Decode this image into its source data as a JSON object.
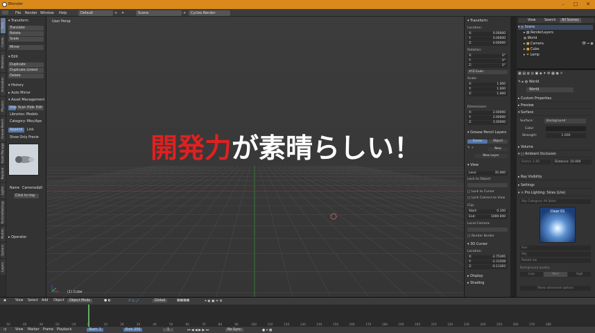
{
  "app": {
    "title": "Blender"
  },
  "menubar": {
    "items": [
      "File",
      "Render",
      "Window",
      "Help"
    ],
    "layout": "Default",
    "scene": "Scene",
    "engine": "Cycles Render"
  },
  "vtabs": [
    "Tools",
    "Create",
    "Relations",
    "Animation",
    "Physics",
    "Grease Pencil",
    "Asset Manage",
    "Replace",
    "Lights",
    "ParticleSettings",
    "Models",
    "Options",
    "Layers"
  ],
  "tools": {
    "transform_header": "Transform",
    "transform": [
      "Translate",
      "Rotate",
      "Scale",
      "Mirror"
    ],
    "edit_header": "Edit",
    "edit": [
      "Duplicate",
      "Duplicate Linked",
      "Delete"
    ],
    "history_header": "History",
    "history": [
      "Auto Mirror"
    ],
    "asset_header": "Asset Management",
    "asset_tabs": [
      "Import",
      "Scale",
      "Hide",
      "Edit"
    ],
    "asset_rows": [
      "Libraries: Models",
      "Category: Misc/Ape"
    ],
    "asset_buttons": [
      "Append",
      "Link"
    ],
    "show_only": "Show Only Previe",
    "name_label": "Name",
    "name_value": "Cameraobj0",
    "click_to_imp": "Click to imp",
    "operator": "Operator"
  },
  "viewport": {
    "label": "User Persp",
    "object": "(1) Cube"
  },
  "caption": {
    "red": "開発力",
    "white": "が素晴らしい！"
  },
  "rpanel": {
    "transform": "Transform",
    "location_label": "Location:",
    "location": [
      [
        "X:",
        "0.00000"
      ],
      [
        "Y:",
        "0.00000"
      ],
      [
        "Z:",
        "0.00000"
      ]
    ],
    "rotation_label": "Rotation:",
    "rotation": [
      [
        "X:",
        "0°"
      ],
      [
        "Y:",
        "0°"
      ],
      [
        "Z:",
        "0°"
      ]
    ],
    "rotation_mode": "XYZ Euler",
    "scale_label": "Scale:",
    "scale": [
      [
        "X:",
        "1.000"
      ],
      [
        "Y:",
        "1.000"
      ],
      [
        "Z:",
        "1.000"
      ]
    ],
    "dimensions_label": "Dimensions:",
    "dimensions": [
      [
        "X:",
        "2.00000"
      ],
      [
        "Y:",
        "2.00000"
      ],
      [
        "Z:",
        "2.00000"
      ]
    ],
    "layers_header": "Grease Pencil Layers",
    "layers_tabs": [
      "Scene",
      "Object"
    ],
    "new_label": "New",
    "new_layer": "New Layer",
    "view_header": "View",
    "lens_label": "Lens:",
    "lens_value": "35.000",
    "lock_to_object": "Lock to Object:",
    "lock_to_cursor": "Lock to Cursor",
    "lock_camera": "Lock Camera to View",
    "clip_label": "Clip:",
    "clip_start": [
      "Start:",
      "0.100"
    ],
    "clip_end": [
      "End:",
      "1000.000"
    ],
    "local_camera": "Local Camera:",
    "render_border": "Render Border",
    "cursor_header": "3D Cursor",
    "cursor_location": "Location:",
    "cursor": [
      [
        "X:",
        "-2.75395"
      ],
      [
        "Y:",
        "-2.31508"
      ],
      [
        "Z:",
        "-0.11393"
      ]
    ],
    "display": "Display",
    "shading": "Shading"
  },
  "outliner": {
    "menu": [
      "View",
      "Search",
      "All Scenes"
    ],
    "rows": [
      "Scene",
      "RenderLayers",
      "World",
      "Camera",
      "Cube",
      "Lamp"
    ]
  },
  "props": {
    "breadcrumb": "World",
    "world_name": "World",
    "sections": [
      "Custom Properties",
      "Preview",
      "Surface"
    ],
    "surface_label": "Surface:",
    "surface_value": "Background",
    "color_label": "Color:",
    "strength_label": "Strength:",
    "strength_value": "1.000",
    "volume": "Volume",
    "ao": "Ambient Occlusion",
    "factor": "Factor:",
    "factor_value": "1.00",
    "distance": "Distance:",
    "distance_value": "10.000",
    "ray_visibility": "Ray Visibility",
    "settings": "Settings",
    "prolight": "Pro Lighting: Skies (Lite)",
    "sky_category": "Sky Category: All Skies",
    "sky_name": "Clear 01",
    "sun_label": "Sun",
    "sky_label": "Sky",
    "rotate_label": "Rotate ow",
    "bg_quality": "Background quality:",
    "bg_tabs": [
      "Low",
      "Med",
      "High"
    ],
    "show_advanced": "Show advanced options"
  },
  "timeline": {
    "toolbar": [
      "View",
      "Select",
      "Add",
      "Object"
    ],
    "mode": "Object Mode",
    "orientation": "Global",
    "ruler": [
      "-50",
      "-40",
      "-30",
      "-20",
      "-10",
      "0",
      "10",
      "20",
      "30",
      "40",
      "50",
      "60",
      "70",
      "80",
      "90",
      "100",
      "110",
      "120",
      "130",
      "140",
      "150",
      "160",
      "170",
      "180",
      "190",
      "200",
      "210",
      "220",
      "230",
      "240",
      "250",
      "260",
      "270",
      "280"
    ],
    "bottom": [
      "View",
      "Marker",
      "Frame",
      "Playback"
    ],
    "start_label": "Start:",
    "start": "1",
    "end_label": "End:",
    "end": "250",
    "current": "1",
    "sync": "No Sync"
  },
  "colors": {
    "accent": "#d98a1a",
    "caption_red": "#e02020",
    "caption_white": "#ffffff"
  }
}
